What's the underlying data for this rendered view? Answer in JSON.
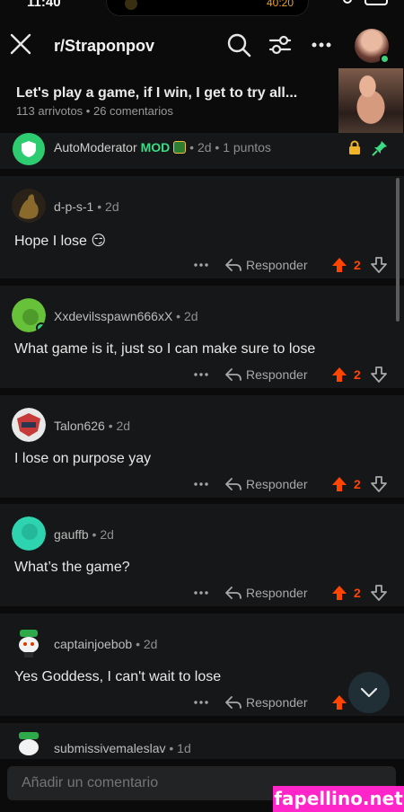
{
  "status": {
    "time": "11:40",
    "timer": "40:20"
  },
  "header": {
    "subreddit": "r/Straponpov"
  },
  "post": {
    "title": "Let's play a game, if I win, I get to try all...",
    "meta": "113 arrivotos • 26 comentarios"
  },
  "automod": {
    "name": "AutoModerator",
    "badge": "MOD",
    "meta": "• 2d • 1 puntos"
  },
  "actions": {
    "reply_label": "Responder"
  },
  "comments": [
    {
      "user": "d-p-s-1",
      "age": "2d",
      "body": "Hope I lose 😏",
      "score": "2",
      "avatar_color": "#6b4b1e"
    },
    {
      "user": "Xxdevilsspawn666xX",
      "age": "2d",
      "body": "What game is it, just so I can make sure to lose",
      "score": "2",
      "avatar_color": "#67c23a"
    },
    {
      "user": "Talon626",
      "age": "2d",
      "body": "I lose on purpose yay",
      "score": "2",
      "avatar_color": "#c73a3a"
    },
    {
      "user": "gauffb",
      "age": "2d",
      "body": "What’s the game?",
      "score": "2",
      "avatar_color": "#2ed3b0"
    },
    {
      "user": "captainjoebob",
      "age": "2d",
      "body": "Yes Goddess, I can't wait to lose",
      "score": "",
      "avatar_color": "#dfe6e9"
    },
    {
      "user": "submissivemaleslav",
      "age": "1d",
      "body": "",
      "score": "",
      "avatar_color": "#dfe6e9"
    }
  ],
  "composer": {
    "placeholder": "Añadir un comentario"
  },
  "watermark": "fapellino.net",
  "colors": {
    "upvote": "#ff4500",
    "mod": "#3ddc84",
    "background": "#0b0b0c",
    "card": "#161718"
  }
}
